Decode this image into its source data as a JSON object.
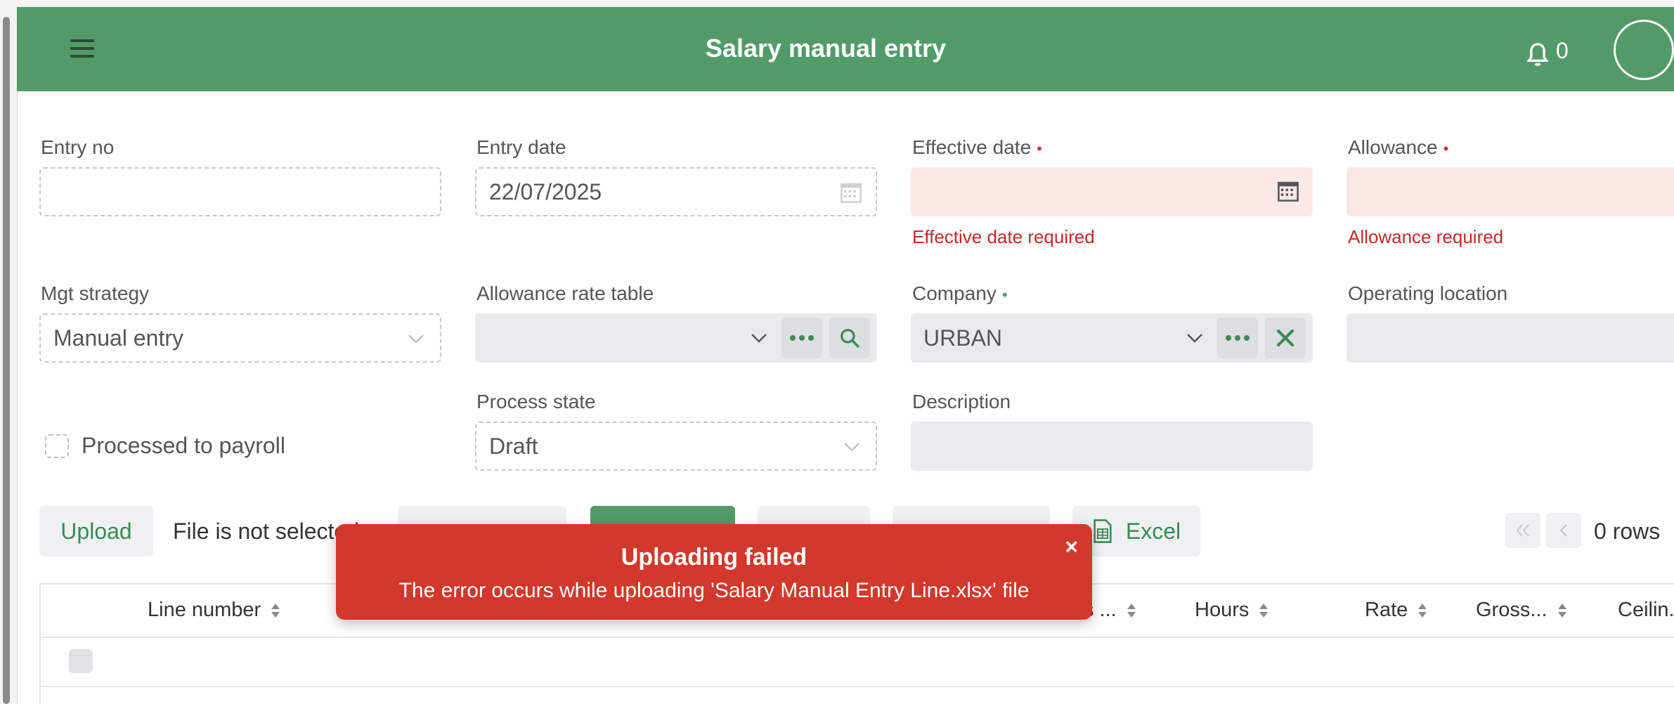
{
  "header": {
    "title": "Salary manual entry",
    "notification_count": "0"
  },
  "form": {
    "entry_no": {
      "label": "Entry no",
      "value": ""
    },
    "entry_date": {
      "label": "Entry date",
      "value": "22/07/2025"
    },
    "effective_date": {
      "label": "Effective date",
      "value": "",
      "error": "Effective date required"
    },
    "allowance": {
      "label": "Allowance",
      "value": "",
      "error": "Allowance required"
    },
    "mgt_strategy": {
      "label": "Mgt strategy",
      "value": "Manual entry"
    },
    "allowance_rate_table": {
      "label": "Allowance rate table",
      "value": ""
    },
    "company": {
      "label": "Company",
      "value": "URBAN"
    },
    "operating_location": {
      "label": "Operating location",
      "value": ""
    },
    "processed_to_payroll": {
      "label": "Processed to payroll",
      "checked": false
    },
    "process_state": {
      "label": "Process state",
      "value": "Draft"
    },
    "description": {
      "label": "Description",
      "value": ""
    }
  },
  "toolbar": {
    "upload_label": "Upload",
    "file_status": "File is not selected",
    "excel_label": "Excel",
    "rows_text": "0 rows"
  },
  "table": {
    "columns": [
      "Line number",
      "Hours",
      "Rate",
      "Gross...",
      "Ceilin..."
    ],
    "partial_column": "s ..."
  },
  "toast": {
    "title": "Uploading failed",
    "message": "The error occurs while uploading 'Salary Manual Entry Line.xlsx' file",
    "close": "×"
  },
  "colors": {
    "primary": "#529b69",
    "error": "#d2382b",
    "error_bg": "#fbe9e7"
  }
}
